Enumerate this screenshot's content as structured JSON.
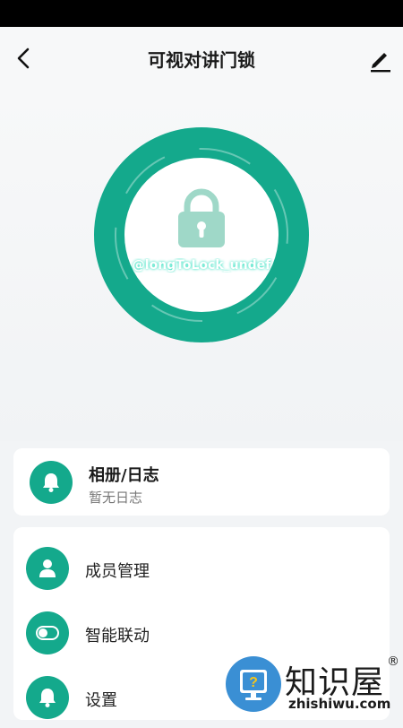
{
  "header": {
    "title": "可视对讲门锁",
    "back_icon": "back-arrow-icon",
    "edit_icon": "edit-pencil-icon"
  },
  "lock": {
    "status_text": "@longToLock_undef",
    "icon": "lock-icon",
    "accent_color": "#14a98c"
  },
  "album": {
    "title": "相册/日志",
    "subtitle": "暂无日志",
    "icon": "bell-icon"
  },
  "menu": {
    "items": [
      {
        "label": "成员管理",
        "icon": "user-icon"
      },
      {
        "label": "智能联动",
        "icon": "toggle-icon"
      },
      {
        "label": "设置",
        "icon": "bell-icon"
      }
    ]
  },
  "watermark": {
    "title": "知识屋",
    "reg": "®",
    "url": "zhishiwu.com",
    "icon": "question-monitor-icon"
  }
}
